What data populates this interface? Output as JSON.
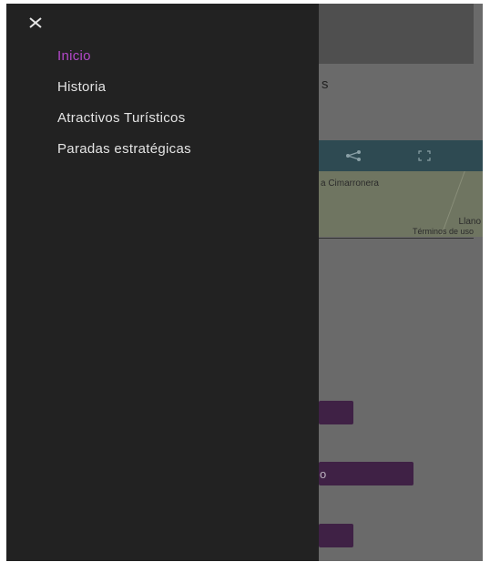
{
  "drawer": {
    "close_icon": "close-icon",
    "items": [
      {
        "label": "Inicio",
        "active": true
      },
      {
        "label": "Historia",
        "active": false
      },
      {
        "label": "Atractivos Turísticos",
        "active": false
      },
      {
        "label": "Paradas estratégicas",
        "active": false
      }
    ],
    "active_color": "#b348c9",
    "background": "#222222"
  },
  "background_page": {
    "heading_fragment": "s",
    "map": {
      "share_icon": "share-icon",
      "fullscreen_icon": "fullscreen-icon",
      "place_label": "a Cimarronera",
      "place_label_2": "Llano",
      "footer_text": "Términos de uso"
    },
    "button_fragment": "o",
    "overlay_color": "#6a6a6a"
  }
}
